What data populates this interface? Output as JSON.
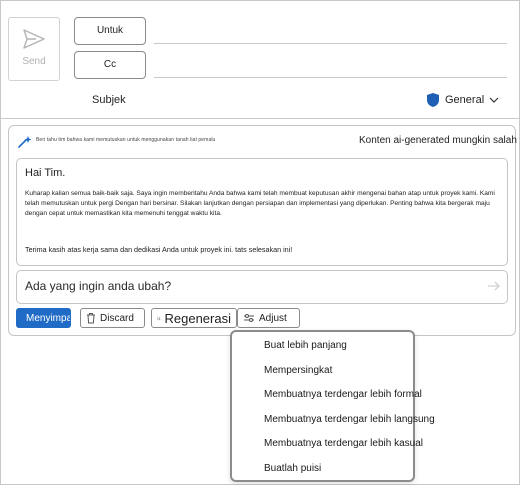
{
  "compose": {
    "send_label": "Send",
    "to_label": "Untuk",
    "cc_label": "Cc",
    "subject_label": "Subjek",
    "sensitivity_label": "General"
  },
  "copilot": {
    "header_text": "Beri tahu tim bahwa kami memutuskan untuk menggunakan tanah liat pemalu",
    "ai_note": "Konten ai-generated mungkin salah",
    "draft": {
      "greeting": "Hai Tim.",
      "paragraph1": "Kuharap kalian semua baik-baik saja. Saya ingin memberitahu Anda bahwa kami telah membuat keputusan akhir mengenai bahan atap untuk proyek kami. Kami telah memutuskan untuk pergi Dengan hari bersinar. Silakan lanjutkan dengan persiapan dan implementasi yang diperlukan. Penting bahwa kita bergerak maju dengan cepat untuk memastikan kita memenuhi tenggat waktu kita.",
      "paragraph2": "Terima kasih atas kerja sama dan dedikasi Anda untuk proyek ini. tats selesakan ini!"
    },
    "prompt_placeholder": "Ada yang ingin anda ubah?",
    "buttons": {
      "keep": "Menyimpan",
      "discard": "Discard",
      "regenerate": "Regenerasi",
      "adjust": "Adjust"
    }
  },
  "adjust_menu": {
    "items": [
      "Buat lebih panjang",
      "Mempersingkat",
      "Membuatnya terdengar lebih formal",
      "Membuatnya terdengar lebih langsung",
      "Membuatnya terdengar lebih kasual",
      "Buatlah puisi"
    ]
  },
  "colors": {
    "accent": "#1f6bc6",
    "shield": "#1f5fb4"
  },
  "icons": {
    "send": "send-icon",
    "shield": "shield-icon",
    "chevron": "chevron-down-icon",
    "copilot": "copilot-sparkle-icon",
    "check": "check-icon",
    "trash": "trash-icon",
    "regenerate": "regenerate-icon",
    "adjust": "sliders-icon"
  }
}
